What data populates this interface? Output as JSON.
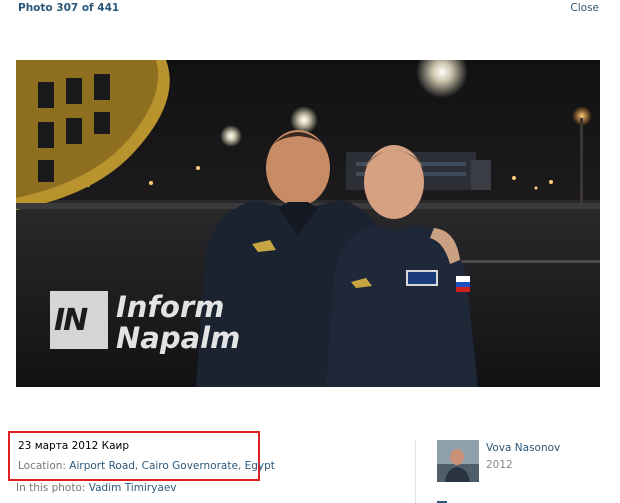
{
  "header": {
    "photo_counter": "Photo 307 of 441",
    "close_label": "Close"
  },
  "photo": {
    "watermark_logo_text": "IN",
    "watermark_line1": "Inform",
    "watermark_line2": "Napalm"
  },
  "details": {
    "date_text": "23 марта 2012 Каир",
    "location_label": "Location: ",
    "location_road": "Airport Road",
    "location_sep1": ", ",
    "location_governorate": "Cairo Governorate",
    "location_sep2": ", ",
    "location_country": "Egypt",
    "in_photo_label": "In this photo: ",
    "in_photo_person": "Vadim Timiryaev"
  },
  "owner": {
    "name": "Vova Nasonov",
    "year": "2012"
  },
  "colors": {
    "link": "#2b587a",
    "highlight_border": "#e02020"
  }
}
